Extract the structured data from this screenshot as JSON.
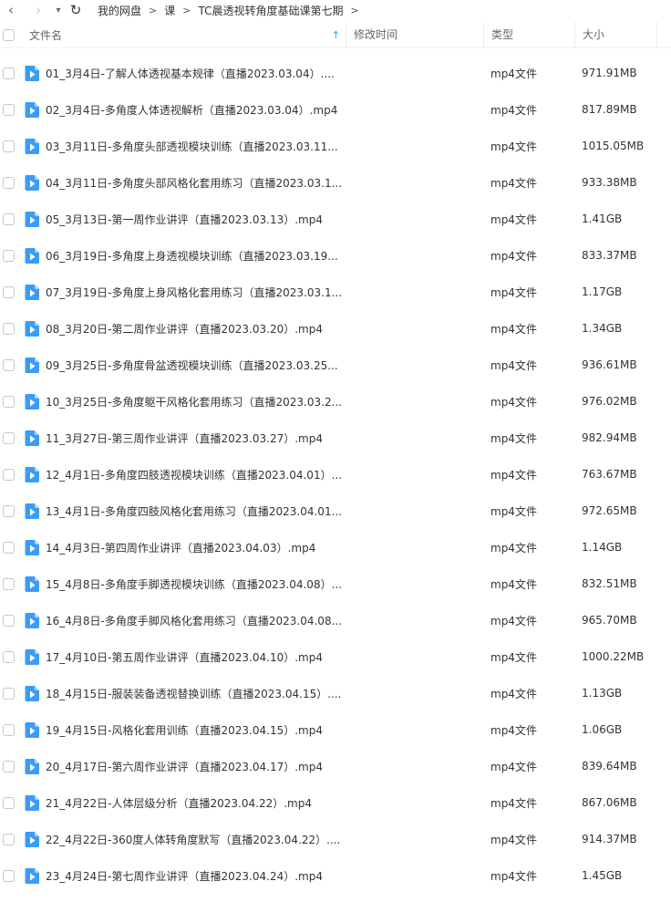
{
  "nav": {
    "back_icon": "‹",
    "forward_icon": "›",
    "menu_icon": "▾",
    "refresh_icon": "↻"
  },
  "breadcrumb": {
    "items": [
      "我的网盘",
      "课",
      "TC晨透视转角度基础课第七期"
    ],
    "separator": ">"
  },
  "table": {
    "headers": {
      "name": "文件名",
      "mtime": "修改时间",
      "type": "类型",
      "size": "大小"
    },
    "sort_icon": "↑",
    "rows": [
      {
        "name": "01_3月4日-了解人体透视基本规律（直播2023.03.04）....",
        "type": "mp4文件",
        "size": "971.91MB"
      },
      {
        "name": "02_3月4日-多角度人体透视解析（直播2023.03.04）.mp4",
        "type": "mp4文件",
        "size": "817.89MB"
      },
      {
        "name": "03_3月11日-多角度头部透视模块训练（直播2023.03.11...",
        "type": "mp4文件",
        "size": "1015.05MB"
      },
      {
        "name": "04_3月11日-多角度头部风格化套用练习（直播2023.03.1...",
        "type": "mp4文件",
        "size": "933.38MB"
      },
      {
        "name": "05_3月13日-第一周作业讲评（直播2023.03.13）.mp4",
        "type": "mp4文件",
        "size": "1.41GB"
      },
      {
        "name": "06_3月19日-多角度上身透视模块训练（直播2023.03.19...",
        "type": "mp4文件",
        "size": "833.37MB"
      },
      {
        "name": "07_3月19日-多角度上身风格化套用练习（直播2023.03.1...",
        "type": "mp4文件",
        "size": "1.17GB"
      },
      {
        "name": "08_3月20日-第二周作业讲评（直播2023.03.20）.mp4",
        "type": "mp4文件",
        "size": "1.34GB"
      },
      {
        "name": "09_3月25日-多角度骨盆透视模块训练（直播2023.03.25...",
        "type": "mp4文件",
        "size": "936.61MB"
      },
      {
        "name": "10_3月25日-多角度躯干风格化套用练习（直播2023.03.2...",
        "type": "mp4文件",
        "size": "976.02MB"
      },
      {
        "name": "11_3月27日-第三周作业讲评（直播2023.03.27）.mp4",
        "type": "mp4文件",
        "size": "982.94MB"
      },
      {
        "name": "12_4月1日-多角度四肢透视模块训练（直播2023.04.01）...",
        "type": "mp4文件",
        "size": "763.67MB"
      },
      {
        "name": "13_4月1日-多角度四肢风格化套用练习（直播2023.04.01...",
        "type": "mp4文件",
        "size": "972.65MB"
      },
      {
        "name": "14_4月3日-第四周作业讲评（直播2023.04.03）.mp4",
        "type": "mp4文件",
        "size": "1.14GB"
      },
      {
        "name": "15_4月8日-多角度手脚透视模块训练（直播2023.04.08）...",
        "type": "mp4文件",
        "size": "832.51MB"
      },
      {
        "name": "16_4月8日-多角度手脚风格化套用练习（直播2023.04.08...",
        "type": "mp4文件",
        "size": "965.70MB"
      },
      {
        "name": "17_4月10日-第五周作业讲评（直播2023.04.10）.mp4",
        "type": "mp4文件",
        "size": "1000.22MB"
      },
      {
        "name": "18_4月15日-服装装备透视替换训练（直播2023.04.15）....",
        "type": "mp4文件",
        "size": "1.13GB"
      },
      {
        "name": "19_4月15日-风格化套用训练（直播2023.04.15）.mp4",
        "type": "mp4文件",
        "size": "1.06GB"
      },
      {
        "name": "20_4月17日-第六周作业讲评（直播2023.04.17）.mp4",
        "type": "mp4文件",
        "size": "839.64MB"
      },
      {
        "name": "21_4月22日-人体层级分析（直播2023.04.22）.mp4",
        "type": "mp4文件",
        "size": "867.06MB"
      },
      {
        "name": "22_4月22日-360度人体转角度默写（直播2023.04.22）....",
        "type": "mp4文件",
        "size": "914.37MB"
      },
      {
        "name": "23_4月24日-第七周作业讲评（直播2023.04.24）.mp4",
        "type": "mp4文件",
        "size": "1.45GB"
      }
    ]
  },
  "colors": {
    "accent": "#06a7ff",
    "icon": "#3b9cf5"
  }
}
